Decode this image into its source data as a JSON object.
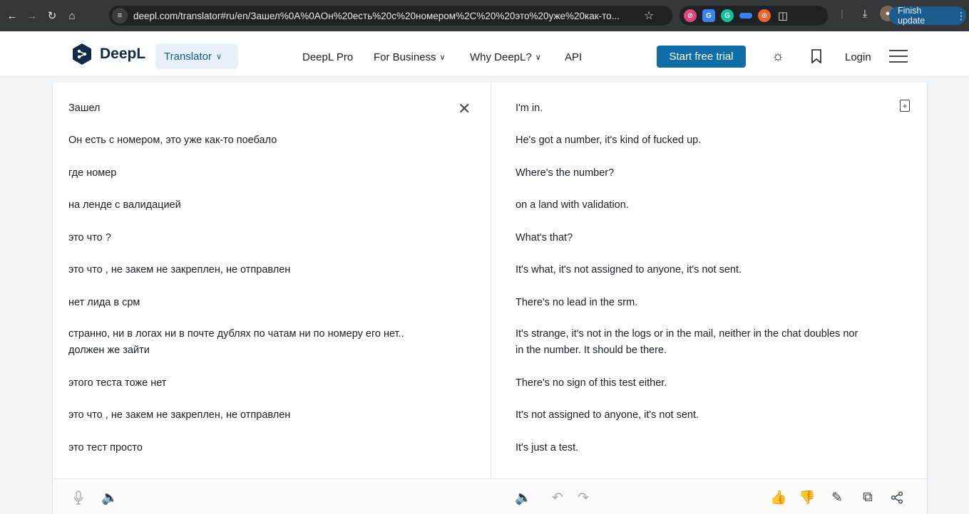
{
  "browser": {
    "url": "deepl.com/translator#ru/en/Зашел%0A%0AОн%20есть%20с%20номером%2C%20%20это%20уже%20как-то...",
    "finish_update": "Finish update",
    "back_icon": "arrow-left-icon",
    "forward_icon": "arrow-right-icon",
    "reload_icon": "reload-icon",
    "home_icon": "home-icon"
  },
  "header": {
    "logo_text": "DeepL",
    "translator_label": "Translator",
    "nav": {
      "pro": "DeepL Pro",
      "business": "For Business",
      "why": "Why DeepL?",
      "api": "API"
    },
    "trial_label": "Start free trial",
    "login_label": "Login",
    "brand_color": "#0f2b46",
    "accent_color": "#0f6ea8"
  },
  "source": {
    "lines": [
      "Зашел",
      "Он есть с номером,  это уже как-то поебало",
      "где номер",
      "на ленде с валидацией",
      "это что ?",
      "это что , не закем не закреплен, не отправлен",
      "нет лида в срм",
      "странно, ни в логах ни в почте дублях по чатам ни по номеру его нет..",
      "должен же зайти",
      "этого теста тоже нет",
      "это что , не закем не закреплен, не отправлен",
      "это тест просто"
    ]
  },
  "target": {
    "lines": [
      "I'm in.",
      "He's got a number, it's kind of fucked up.",
      "Where's the number?",
      "on a land with validation.",
      "What's that?",
      "It's what, it's not assigned to anyone, it's not sent.",
      "There's no lead in the srm.",
      "It's strange, it's not in the logs or in the mail, neither in the chat doubles nor",
      "in the number. It should be there.",
      "There's no sign of this test either.",
      "It's not assigned to anyone, it's not sent.",
      "It's just a test."
    ]
  }
}
